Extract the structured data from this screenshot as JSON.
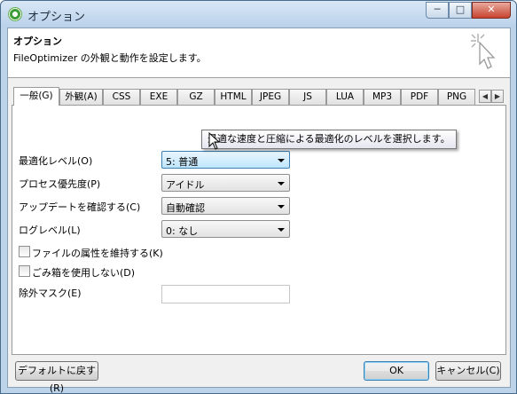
{
  "window": {
    "title": "オプション",
    "minimize": "─",
    "maximize": "□",
    "close": "✕"
  },
  "header": {
    "title": "オプション",
    "description": "FileOptimizer の外観と動作を設定します。"
  },
  "tabs": [
    {
      "label": "一般(G)",
      "active": true
    },
    {
      "label": "外観(A)"
    },
    {
      "label": "CSS"
    },
    {
      "label": "EXE"
    },
    {
      "label": "GZ"
    },
    {
      "label": "HTML"
    },
    {
      "label": "JPEG"
    },
    {
      "label": "JS"
    },
    {
      "label": "LUA"
    },
    {
      "label": "MP3"
    },
    {
      "label": "PDF"
    },
    {
      "label": "PNG"
    }
  ],
  "tab_scroll": {
    "left": "◀",
    "right": "▶"
  },
  "settings": {
    "optimization_level": {
      "label": "最適化レベル(O)",
      "value": "5: 普通"
    },
    "process_priority": {
      "label": "プロセス優先度(P)",
      "value": "アイドル"
    },
    "check_updates": {
      "label": "アップデートを確認する(C)",
      "value": "自動確認"
    },
    "log_level": {
      "label": "ログレベル(L)",
      "value": "0: なし"
    },
    "keep_attributes": {
      "label": "ファイルの属性を維持する(K)",
      "checked": false
    },
    "no_recycle_bin": {
      "label": "ごみ箱を使用しない(D)",
      "checked": false
    },
    "exclude_mask": {
      "label": "除外マスク(E)",
      "value": ""
    }
  },
  "tooltip": "最適な速度と圧縮による最適化のレベルを選択します。",
  "buttons": {
    "defaults": "デフォルトに戻す(R)",
    "ok": "OK",
    "cancel": "キャンセル(C)"
  }
}
